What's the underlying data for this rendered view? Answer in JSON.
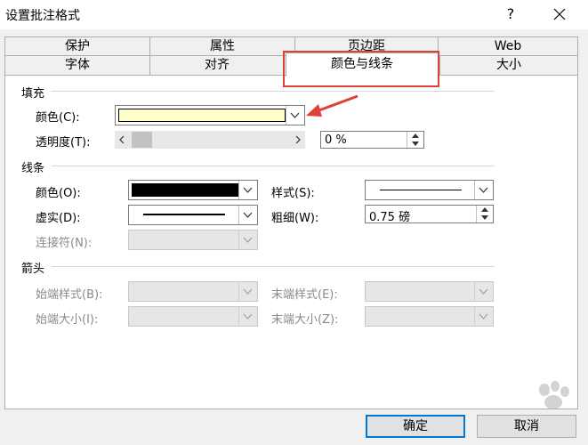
{
  "window": {
    "title": "设置批注格式",
    "help": "?"
  },
  "tabs_top": [
    "保护",
    "属性",
    "页边距",
    "Web"
  ],
  "tabs_bottom": [
    "字体",
    "对齐",
    "颜色与线条",
    "大小"
  ],
  "fill": {
    "section": "填充",
    "color_label": "颜色(C):",
    "color_value": "#ffffcc",
    "transparency_label": "透明度(T):",
    "transparency_value": "0 %",
    "transparency_fraction": 0
  },
  "line": {
    "section": "线条",
    "color_label": "颜色(O):",
    "color_value": "#000000",
    "style_label": "样式(S):",
    "dash_label": "虚实(D):",
    "weight_label": "粗细(W):",
    "weight_value": "0.75 磅",
    "connector_label": "连接符(N):"
  },
  "arrows": {
    "section": "箭头",
    "begin_style_label": "始端样式(B):",
    "end_style_label": "末端样式(E):",
    "begin_size_label": "始端大小(I):",
    "end_size_label": "末端大小(Z):"
  },
  "buttons": {
    "ok": "确定",
    "cancel": "取消"
  },
  "colors": {
    "annotation_red": "#e0403a",
    "focus_blue": "#0078d7"
  }
}
